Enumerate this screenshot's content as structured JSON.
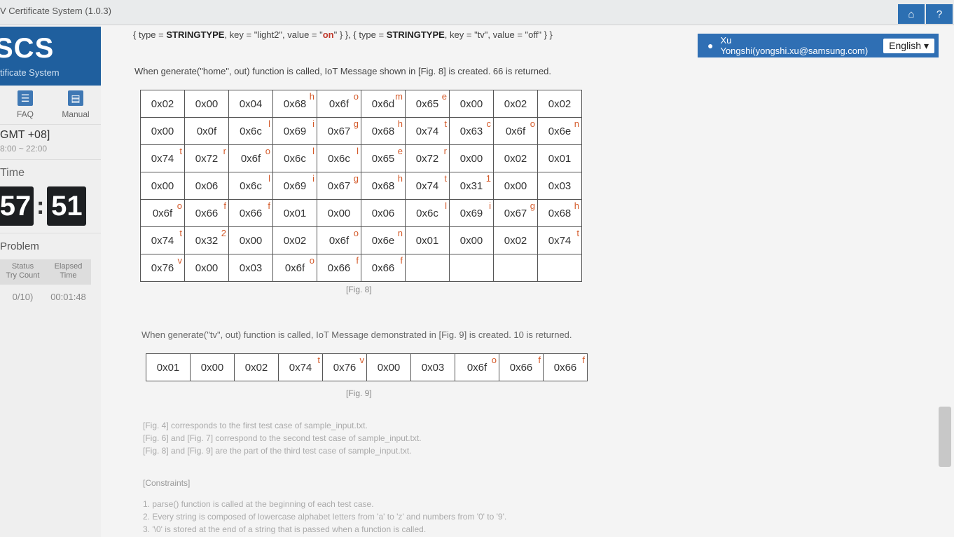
{
  "window": {
    "title": "V Certificate System (1.0.3)",
    "home_icon": "⌂",
    "help_icon": "?"
  },
  "sidebar": {
    "logo": "SCS",
    "subtitle": "tificate System",
    "faq_label": "FAQ",
    "manual_label": "Manual",
    "timezone": "GMT +08]",
    "hours": "8:00 ~ 22:00",
    "time_label": "Time",
    "clock_min": "57",
    "clock_sep": ":",
    "clock_sec": "51",
    "problem_label": "Problem",
    "status_header": "Status\nTry Count",
    "elapsed_header": "Elapsed\nTime",
    "status_value": "0/10)",
    "elapsed_value": "00:01:48"
  },
  "user": {
    "name": "Xu Yongshi(yongshi.xu@samsung.com)",
    "language": "English ▾"
  },
  "content": {
    "line_top_a": "{ type = ",
    "line_top_b": "STRINGTYPE",
    "line_top_c": ", key = \"light2\", value = \"",
    "line_top_d": "on",
    "line_top_e": "\" } }, { type = ",
    "line_top_f": "STRINGTYPE",
    "line_top_g": ", key = \"tv\", value = \"off\" } }",
    "desc8": "When generate(\"home\", out) function is called, IoT Message shown in [Fig. 8] is created. 66 is returned.",
    "fig8_caption": "[Fig. 8]",
    "desc9": "When generate(\"tv\", out) function is called, IoT Message demonstrated in [Fig. 9] is created. 10 is returned.",
    "fig9_caption": "[Fig. 9]",
    "notes": [
      "[Fig. 4] corresponds to the first test case of sample_input.txt.",
      "[Fig. 6] and [Fig. 7] correspond to the second test case of sample_input.txt.",
      "[Fig. 8] and [Fig. 9] are the part of the third test case of sample_input.txt."
    ],
    "constraints_title": "[Constraints]",
    "constraints": [
      "1. parse() function is called at the beginning of each test case.",
      "2. Every string is composed of lowercase alphabet letters from 'a' to 'z' and numbers from '0' to '9'.",
      "3. '\\0' is stored at the end of a string that is passed when a function is called."
    ]
  },
  "fig8": [
    [
      [
        "0x02",
        ""
      ],
      [
        "0x00",
        ""
      ],
      [
        "0x04",
        ""
      ],
      [
        "0x68",
        "h"
      ],
      [
        "0x6f",
        "o"
      ],
      [
        "0x6d",
        "m"
      ],
      [
        "0x65",
        "e"
      ],
      [
        "0x00",
        ""
      ],
      [
        "0x02",
        ""
      ],
      [
        "0x02",
        ""
      ]
    ],
    [
      [
        "0x00",
        ""
      ],
      [
        "0x0f",
        ""
      ],
      [
        "0x6c",
        "l"
      ],
      [
        "0x69",
        "i"
      ],
      [
        "0x67",
        "g"
      ],
      [
        "0x68",
        "h"
      ],
      [
        "0x74",
        "t"
      ],
      [
        "0x63",
        "c"
      ],
      [
        "0x6f",
        "o"
      ],
      [
        "0x6e",
        "n"
      ]
    ],
    [
      [
        "0x74",
        "t"
      ],
      [
        "0x72",
        "r"
      ],
      [
        "0x6f",
        "o"
      ],
      [
        "0x6c",
        "l"
      ],
      [
        "0x6c",
        "l"
      ],
      [
        "0x65",
        "e"
      ],
      [
        "0x72",
        "r"
      ],
      [
        "0x00",
        ""
      ],
      [
        "0x02",
        ""
      ],
      [
        "0x01",
        ""
      ]
    ],
    [
      [
        "0x00",
        ""
      ],
      [
        "0x06",
        ""
      ],
      [
        "0x6c",
        "l"
      ],
      [
        "0x69",
        "i"
      ],
      [
        "0x67",
        "g"
      ],
      [
        "0x68",
        "h"
      ],
      [
        "0x74",
        "t"
      ],
      [
        "0x31",
        "1"
      ],
      [
        "0x00",
        ""
      ],
      [
        "0x03",
        ""
      ]
    ],
    [
      [
        "0x6f",
        "o"
      ],
      [
        "0x66",
        "f"
      ],
      [
        "0x66",
        "f"
      ],
      [
        "0x01",
        ""
      ],
      [
        "0x00",
        ""
      ],
      [
        "0x06",
        ""
      ],
      [
        "0x6c",
        "l"
      ],
      [
        "0x69",
        "i"
      ],
      [
        "0x67",
        "g"
      ],
      [
        "0x68",
        "h"
      ]
    ],
    [
      [
        "0x74",
        "t"
      ],
      [
        "0x32",
        "2"
      ],
      [
        "0x00",
        ""
      ],
      [
        "0x02",
        ""
      ],
      [
        "0x6f",
        "o"
      ],
      [
        "0x6e",
        "n"
      ],
      [
        "0x01",
        ""
      ],
      [
        "0x00",
        ""
      ],
      [
        "0x02",
        ""
      ],
      [
        "0x74",
        "t"
      ]
    ],
    [
      [
        "0x76",
        "v"
      ],
      [
        "0x00",
        ""
      ],
      [
        "0x03",
        ""
      ],
      [
        "0x6f",
        "o"
      ],
      [
        "0x66",
        "f"
      ],
      [
        "0x66",
        "f"
      ],
      [
        "",
        ""
      ],
      [
        "",
        ""
      ],
      [
        "",
        ""
      ],
      [
        "",
        ""
      ]
    ]
  ],
  "fig9": [
    [
      [
        "0x01",
        ""
      ],
      [
        "0x00",
        ""
      ],
      [
        "0x02",
        ""
      ],
      [
        "0x74",
        "t"
      ],
      [
        "0x76",
        "v"
      ],
      [
        "0x00",
        ""
      ],
      [
        "0x03",
        ""
      ],
      [
        "0x6f",
        "o"
      ],
      [
        "0x66",
        "f"
      ],
      [
        "0x66",
        "f"
      ]
    ]
  ]
}
